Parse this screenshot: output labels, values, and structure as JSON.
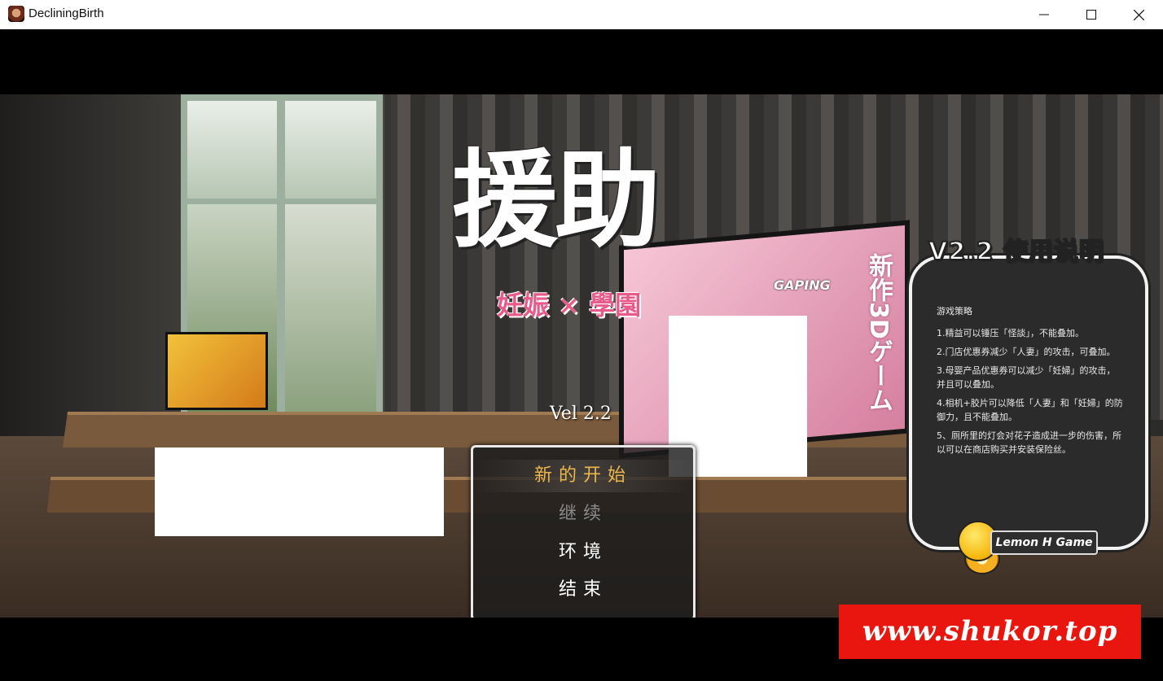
{
  "window": {
    "title": "DecliningBirth",
    "icon": "app-icon"
  },
  "logo": {
    "title": "援助",
    "subtitle": "妊娠 × 學園"
  },
  "version": "Vel 2.2",
  "menu": {
    "items": [
      {
        "label": "新的开始",
        "state": "selected"
      },
      {
        "label": "继续",
        "state": "disabled"
      },
      {
        "label": "环境",
        "state": "normal"
      },
      {
        "label": "结束",
        "state": "normal"
      }
    ]
  },
  "instructions": {
    "title": "V2.2 使用说明",
    "heading": "游戏策略",
    "items": [
      "1.精益可以锤压「怪談」，不能叠加。",
      "2.门店优惠券减少「人妻」的攻击，可叠加。",
      "3.母婴产品优惠券可以减少「妊婦」的攻击，并且可以叠加。",
      "4.相机+胶片可以降低「人妻」和「妊婦」的防御力，且不能叠加。",
      "5、厕所里的灯会对花子造成进一步的伤害，所以可以在商店购买并安装保险丝。"
    ]
  },
  "brand": {
    "name": "Lemon H Game"
  },
  "poster": {
    "vertical_text": "新作3Dゲーム",
    "logo": "GAPING"
  },
  "watermark": "www.shukor.top"
}
